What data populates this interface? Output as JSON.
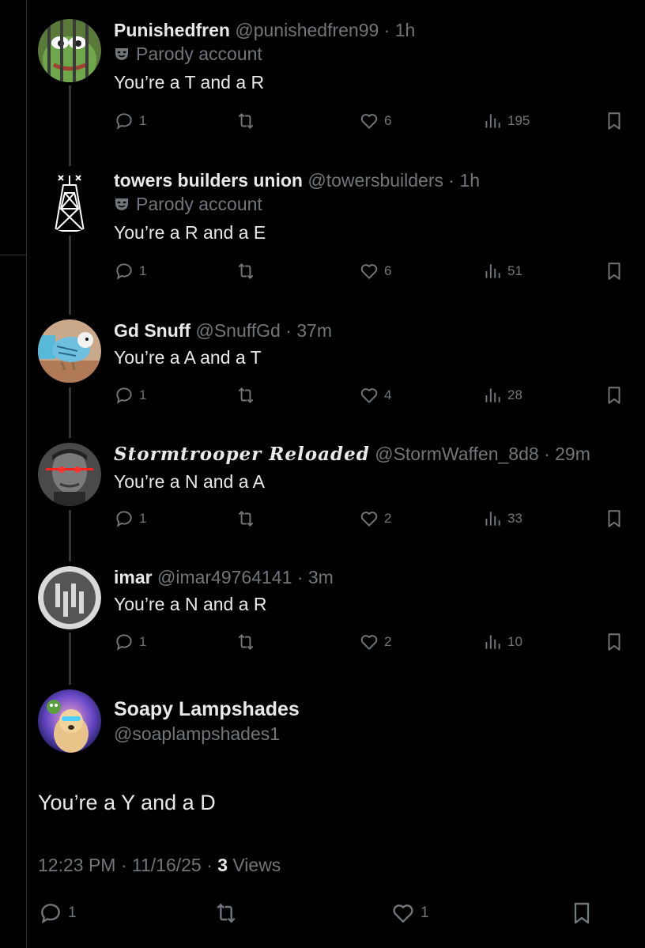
{
  "replies": [
    {
      "name": "Punishedfren",
      "handle": "@punishedfren99",
      "sep": " · ",
      "time": "1h",
      "parody": "Parody account",
      "text": "You’re a T and a R",
      "stats": {
        "replies": "1",
        "likes": "6",
        "views": "195"
      }
    },
    {
      "name": "towers builders union",
      "handle": "@towersbuilders",
      "sep": " · ",
      "time": "1h",
      "parody": "Parody account",
      "text": "You’re a R and a E",
      "stats": {
        "replies": "1",
        "likes": "6",
        "views": "51"
      }
    },
    {
      "name": "Gd Snuff",
      "handle": "@SnuffGd",
      "sep": " · ",
      "time": "37m",
      "text": "You’re a A and a T",
      "stats": {
        "replies": "1",
        "likes": "4",
        "views": "28"
      }
    },
    {
      "name": "Stormtrooper Reloaded",
      "handle": "@StormWaffen_8d8",
      "sep": " · ",
      "time": "29m",
      "text": "You’re a N and a A",
      "stats": {
        "replies": "1",
        "likes": "2",
        "views": "33"
      }
    },
    {
      "name": "imar",
      "handle": "@imar49764141",
      "sep": " · ",
      "time": "3m",
      "text": "You’re a N and a R",
      "stats": {
        "replies": "1",
        "likes": "2",
        "views": "10"
      }
    }
  ],
  "main": {
    "name": "Soapy Lampshades",
    "handle": "@soaplampshades1",
    "text": "You’re a Y and a D",
    "time": "12:23 PM",
    "date": "11/16/25",
    "sep": " · ",
    "views_count": "3",
    "views_label": " Views",
    "stats": {
      "replies": "1",
      "likes": "1"
    }
  },
  "icons": [
    "reply-icon",
    "retweet-icon",
    "like-icon",
    "views-icon",
    "bookmark-icon",
    "parody-mask-icon"
  ],
  "colors": {
    "background": "#000000",
    "text": "#e7e9ea",
    "muted": "#71767b",
    "divider": "#2f3336"
  }
}
